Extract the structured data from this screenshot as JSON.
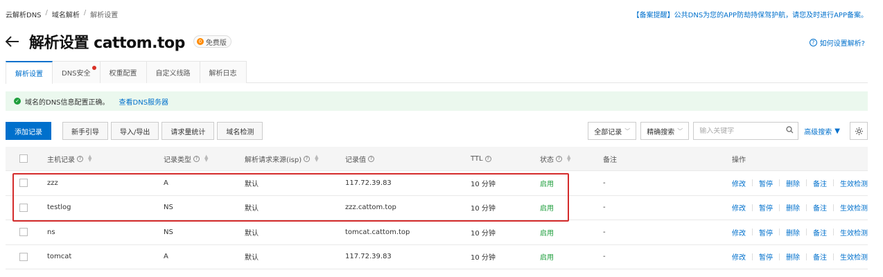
{
  "breadcrumb": [
    "云解析DNS",
    "域名解析",
    "解析设置"
  ],
  "notice": {
    "tag": "【备案提醒】",
    "text": "公共DNS为您的APP防劫持保驾护航，请您及时进行APP备案。"
  },
  "page": {
    "title": "解析设置 cattom.top",
    "badge": "免费版",
    "help": "如何设置解析?"
  },
  "tabs": [
    {
      "label": "解析设置",
      "active": true
    },
    {
      "label": "DNS安全",
      "dot": true
    },
    {
      "label": "权重配置"
    },
    {
      "label": "自定义线路"
    },
    {
      "label": "解析日志"
    }
  ],
  "alert": {
    "text": "域名的DNS信息配置正确。",
    "link": "查看DNS服务器"
  },
  "toolbar": {
    "add": "添加记录",
    "guide": "新手引导",
    "import_export": "导入/导出",
    "stats": "请求量统计",
    "check": "域名检测",
    "filter_all": "全部记录",
    "filter_mode": "精确搜索",
    "search_placeholder": "输入关键字",
    "advanced": "高级搜索"
  },
  "columns": {
    "host": "主机记录",
    "type": "记录类型",
    "isp": "解析请求来源(isp)",
    "value": "记录值",
    "ttl": "TTL",
    "status": "状态",
    "note": "备注",
    "ops": "操作"
  },
  "rows": [
    {
      "host": "zzz",
      "type": "A",
      "isp": "默认",
      "value": "117.72.39.83",
      "ttl": "10 分钟",
      "status": "启用",
      "note": "-"
    },
    {
      "host": "testlog",
      "type": "NS",
      "isp": "默认",
      "value": "zzz.cattom.top",
      "ttl": "10 分钟",
      "status": "启用",
      "note": "-"
    },
    {
      "host": "ns",
      "type": "NS",
      "isp": "默认",
      "value": "tomcat.cattom.top",
      "ttl": "10 分钟",
      "status": "启用",
      "note": "-"
    },
    {
      "host": "tomcat",
      "type": "A",
      "isp": "默认",
      "value": "117.72.39.83",
      "ttl": "10 分钟",
      "status": "启用",
      "note": "-"
    }
  ],
  "row_actions": [
    "修改",
    "暂停",
    "删除",
    "备注",
    "生效检测"
  ],
  "colors": {
    "primary": "#0070cc",
    "success": "#1e9e3c",
    "highlight": "#d42b2b"
  }
}
